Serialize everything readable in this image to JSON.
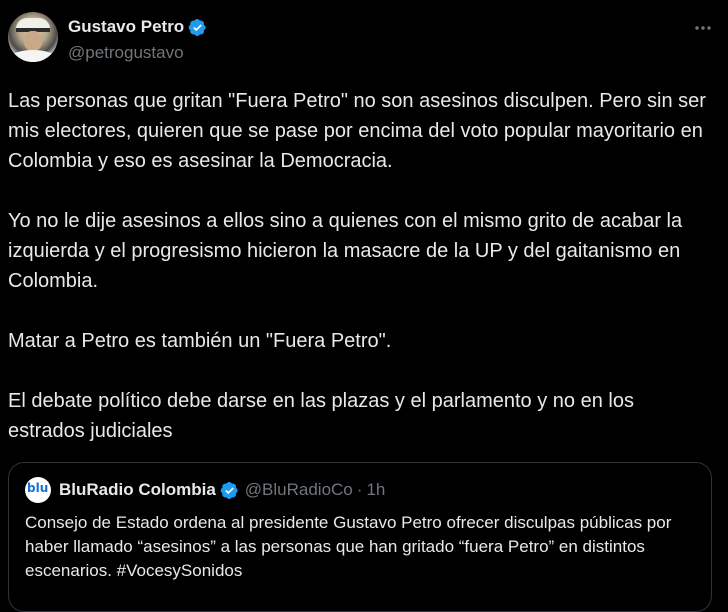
{
  "author": {
    "display_name": "Gustavo Petro",
    "handle": "@petrogustavo",
    "verified": true
  },
  "more_icon": "more-horizontal-icon",
  "tweet": {
    "paragraphs": [
      "Las personas que gritan \"Fuera Petro\" no son asesinos disculpen. Pero sin ser mis electores, quieren que se pase por encima del voto popular mayoritario en Colombia y eso es asesinar la Democracia.",
      "Yo no le dije asesinos a ellos sino a quienes con el mismo grito de acabar la izquierda y el progresismo hicieron la masacre de la UP y del gaitanismo en Colombia.",
      "Matar a Petro es también un \"Fuera Petro\".",
      "El debate político debe darse en las plazas y el parlamento y no en los estrados judiciales"
    ]
  },
  "quoted": {
    "logo_text": "blu",
    "display_name": "BluRadio Colombia",
    "handle": "@BluRadioCo",
    "separator": "·",
    "time": "1h",
    "verified": true,
    "text": "Consejo de Estado ordena al presidente Gustavo Petro ofrecer disculpas públicas por haber llamado “asesinos” a las personas que han gritado “fuera Petro” en distintos escenarios. #VocesySonidos"
  },
  "colors": {
    "background": "#000000",
    "text": "#e7e9ea",
    "muted": "#71767b",
    "verified_blue": "#1d9bf0",
    "border": "#2f3336"
  }
}
